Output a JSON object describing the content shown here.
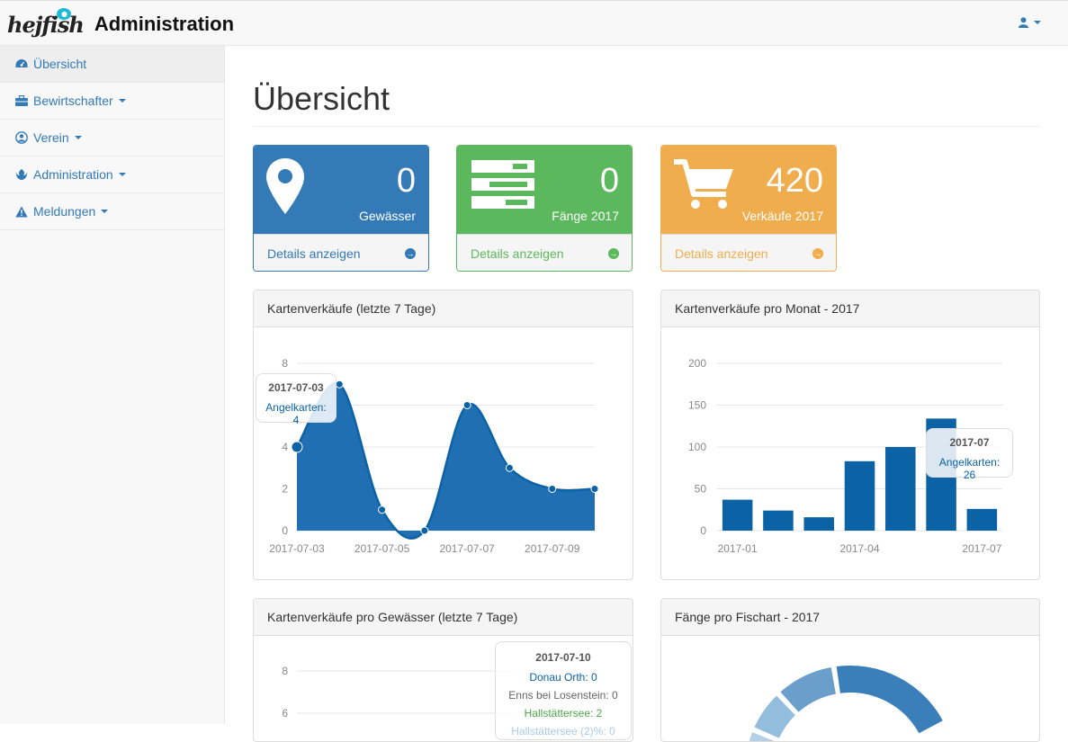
{
  "nav": {
    "brand_logo": "hejfish",
    "brand_title": "Administration"
  },
  "sidebar": {
    "items": [
      {
        "label": "Übersicht",
        "icon": "dashboard-icon"
      },
      {
        "label": "Bewirtschafter",
        "icon": "briefcase-icon"
      },
      {
        "label": "Verein",
        "icon": "user-circle-icon"
      },
      {
        "label": "Administration",
        "icon": "rebel-icon"
      },
      {
        "label": "Meldungen",
        "icon": "warning-icon"
      }
    ]
  },
  "page": {
    "title": "Übersicht"
  },
  "stats": [
    {
      "value": "0",
      "label": "Gewässer",
      "link": "Details anzeigen",
      "color": "#337ab7",
      "icon": "map-marker-icon"
    },
    {
      "value": "0",
      "label": "Fänge 2017",
      "link": "Details anzeigen",
      "color": "#5cb85c",
      "icon": "tasks-icon"
    },
    {
      "value": "420",
      "label": "Verkäufe 2017",
      "link": "Details anzeigen",
      "color": "#f0ad4e",
      "icon": "shopping-cart-icon"
    }
  ],
  "charts": {
    "c1": {
      "title": "Kartenverkäufe (letzte 7 Tage)",
      "tooltip": {
        "date": "2017-07-03",
        "text": "Angelkarten: 4"
      }
    },
    "c2": {
      "title": "Kartenverkäufe pro Monat - 2017",
      "tooltip": {
        "date": "2017-07",
        "text": "Angelkarten: 26"
      }
    },
    "c3": {
      "title": "Kartenverkäufe pro Gewässer (letzte 7 Tage)",
      "tooltip": {
        "date": "2017-07-10",
        "lines": [
          "Donau Orth: 0",
          "Enns bei Losenstein: 0",
          "Hallstättersee: 2",
          "Hallstättersee (2)%: 0"
        ]
      }
    },
    "c4": {
      "title": "Fänge pro Fischart - 2017"
    }
  },
  "chart_data": [
    {
      "type": "area",
      "title": "Kartenverkäufe (letzte 7 Tage)",
      "x": [
        "2017-07-03",
        "2017-07-04",
        "2017-07-05",
        "2017-07-06",
        "2017-07-07",
        "2017-07-08",
        "2017-07-09",
        "2017-07-10"
      ],
      "xticks": [
        "2017-07-03",
        "2017-07-05",
        "2017-07-07",
        "2017-07-09"
      ],
      "series": [
        {
          "name": "Angelkarten",
          "values": [
            4,
            7,
            1,
            0,
            6,
            3,
            2,
            2
          ]
        }
      ],
      "ylim": [
        0,
        8
      ],
      "yticks": [
        0,
        2,
        4,
        6,
        8
      ],
      "color": "#1f6fb2"
    },
    {
      "type": "bar",
      "title": "Kartenverkäufe pro Monat - 2017",
      "categories": [
        "2017-01",
        "2017-02",
        "2017-03",
        "2017-04",
        "2017-05",
        "2017-06",
        "2017-07"
      ],
      "xticks": [
        "2017-01",
        "2017-04",
        "2017-07"
      ],
      "series": [
        {
          "name": "Angelkarten",
          "values": [
            37,
            24,
            16,
            83,
            100,
            134,
            26
          ]
        }
      ],
      "ylim": [
        0,
        200
      ],
      "yticks": [
        0,
        50,
        100,
        150,
        200
      ],
      "color": "#0b62a4"
    },
    {
      "type": "line",
      "title": "Kartenverkäufe pro Gewässer (letzte 7 Tage)",
      "yticks": [
        6,
        8
      ],
      "series": [
        {
          "name": "Donau Orth",
          "values": [
            0
          ]
        },
        {
          "name": "Enns bei Losenstein",
          "values": [
            0
          ]
        },
        {
          "name": "Hallstättersee",
          "values": [
            2
          ]
        },
        {
          "name": "Hallstättersee (2)%",
          "values": [
            0
          ]
        }
      ]
    },
    {
      "type": "pie",
      "title": "Fänge pro Fischart - 2017",
      "colors": [
        "#3a7fba",
        "#6a9ecb",
        "#93bddd",
        "#b5cfe6"
      ]
    }
  ]
}
